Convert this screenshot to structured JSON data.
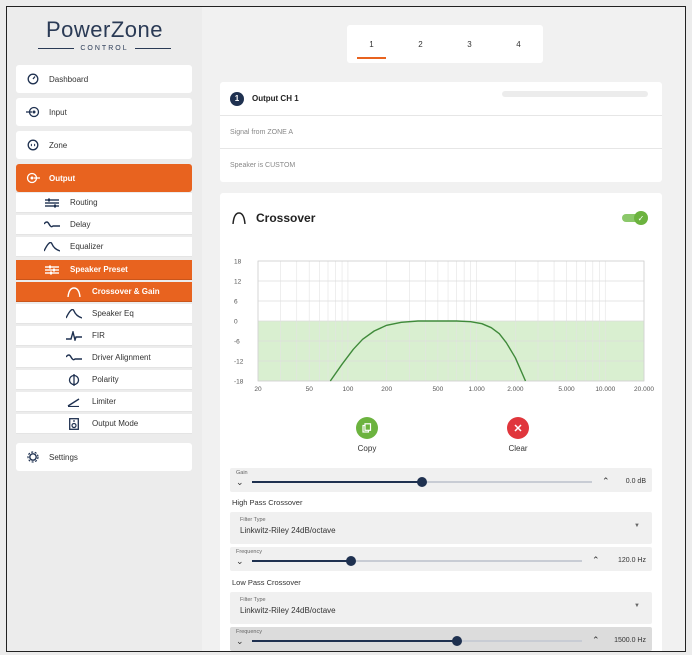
{
  "app": {
    "logo_title": "PowerZone",
    "logo_subtitle": "CONTROL"
  },
  "sidebar": {
    "items": [
      {
        "label": "Dashboard",
        "icon": "dashboard-icon"
      },
      {
        "label": "Input",
        "icon": "input-icon"
      },
      {
        "label": "Zone",
        "icon": "zone-icon"
      },
      {
        "label": "Output",
        "icon": "output-icon",
        "active": true
      },
      {
        "label": "Settings",
        "icon": "settings-icon"
      }
    ],
    "output_sub": [
      {
        "label": "Routing",
        "icon": "routing-icon"
      },
      {
        "label": "Delay",
        "icon": "delay-icon"
      },
      {
        "label": "Equalizer",
        "icon": "equalizer-icon"
      },
      {
        "label": "Speaker Preset",
        "icon": "speaker-preset-icon",
        "active": true
      }
    ],
    "preset_sub": [
      {
        "label": "Crossover & Gain",
        "icon": "crossover-icon",
        "active": true
      },
      {
        "label": "Speaker Eq",
        "icon": "speaker-eq-icon"
      },
      {
        "label": "FIR",
        "icon": "fir-icon"
      },
      {
        "label": "Driver Alignment",
        "icon": "driver-alignment-icon"
      },
      {
        "label": "Polarity",
        "icon": "polarity-icon"
      },
      {
        "label": "Limiter",
        "icon": "limiter-icon"
      },
      {
        "label": "Output Mode",
        "icon": "output-mode-icon"
      }
    ]
  },
  "tabs": [
    "1",
    "2",
    "3",
    "4"
  ],
  "active_tab": 0,
  "channel": {
    "number": "1",
    "title": "Output CH 1",
    "signal": "Signal from ZONE A",
    "speaker": "Speaker is CUSTOM"
  },
  "crossover": {
    "title": "Crossover",
    "enabled": true,
    "copy_label": "Copy",
    "clear_label": "Clear",
    "copy_color": "#6cb33f",
    "clear_color": "#e0363c",
    "gain": {
      "label": "Gain",
      "value": "0.0 dB",
      "fraction": 0.5
    },
    "high_pass": {
      "title": "High Pass Crossover",
      "filter_label": "Filter Type",
      "filter_value": "Linkwitz-Riley 24dB/octave",
      "freq_label": "Frequency",
      "freq_value": "120.0 Hz",
      "fraction": 0.3
    },
    "low_pass": {
      "title": "Low Pass Crossover",
      "filter_label": "Filter Type",
      "filter_value": "Linkwitz-Riley 24dB/octave",
      "freq_label": "Frequency",
      "freq_value": "1500.0 Hz",
      "fraction": 0.62
    }
  },
  "colors": {
    "accent": "#e8631f",
    "navy": "#1f3150",
    "curve": "#3f8a3a",
    "band": "#d9efd0"
  },
  "chart_data": {
    "type": "line",
    "x_scale": "log",
    "xlim": [
      20,
      20000
    ],
    "ylim": [
      -18,
      18
    ],
    "y_ticks": [
      18,
      12,
      6,
      0,
      -6,
      -12,
      -18
    ],
    "y_tick_labels": [
      "18",
      "12",
      "6",
      "0",
      "-6",
      "-12",
      "-18"
    ],
    "x_ticks": [
      20,
      50,
      100,
      200,
      500,
      1000,
      2000,
      5000,
      10000,
      20000
    ],
    "x_tick_labels": [
      "20",
      "50",
      "100",
      "200",
      "500",
      "1.000",
      "2.000",
      "5.000",
      "10.000",
      "20.000"
    ],
    "grid": true,
    "series": [
      {
        "x": [
          73,
          90,
          110,
          130,
          160,
          200,
          260,
          350,
          500,
          700,
          900,
          1100,
          1300,
          1500,
          1700,
          2000,
          2400
        ],
        "y": [
          -18,
          -13,
          -8.5,
          -5.5,
          -3,
          -1.3,
          -0.4,
          0,
          0,
          0,
          -0.2,
          -0.8,
          -2,
          -3.8,
          -6.5,
          -11,
          -18
        ]
      }
    ]
  }
}
